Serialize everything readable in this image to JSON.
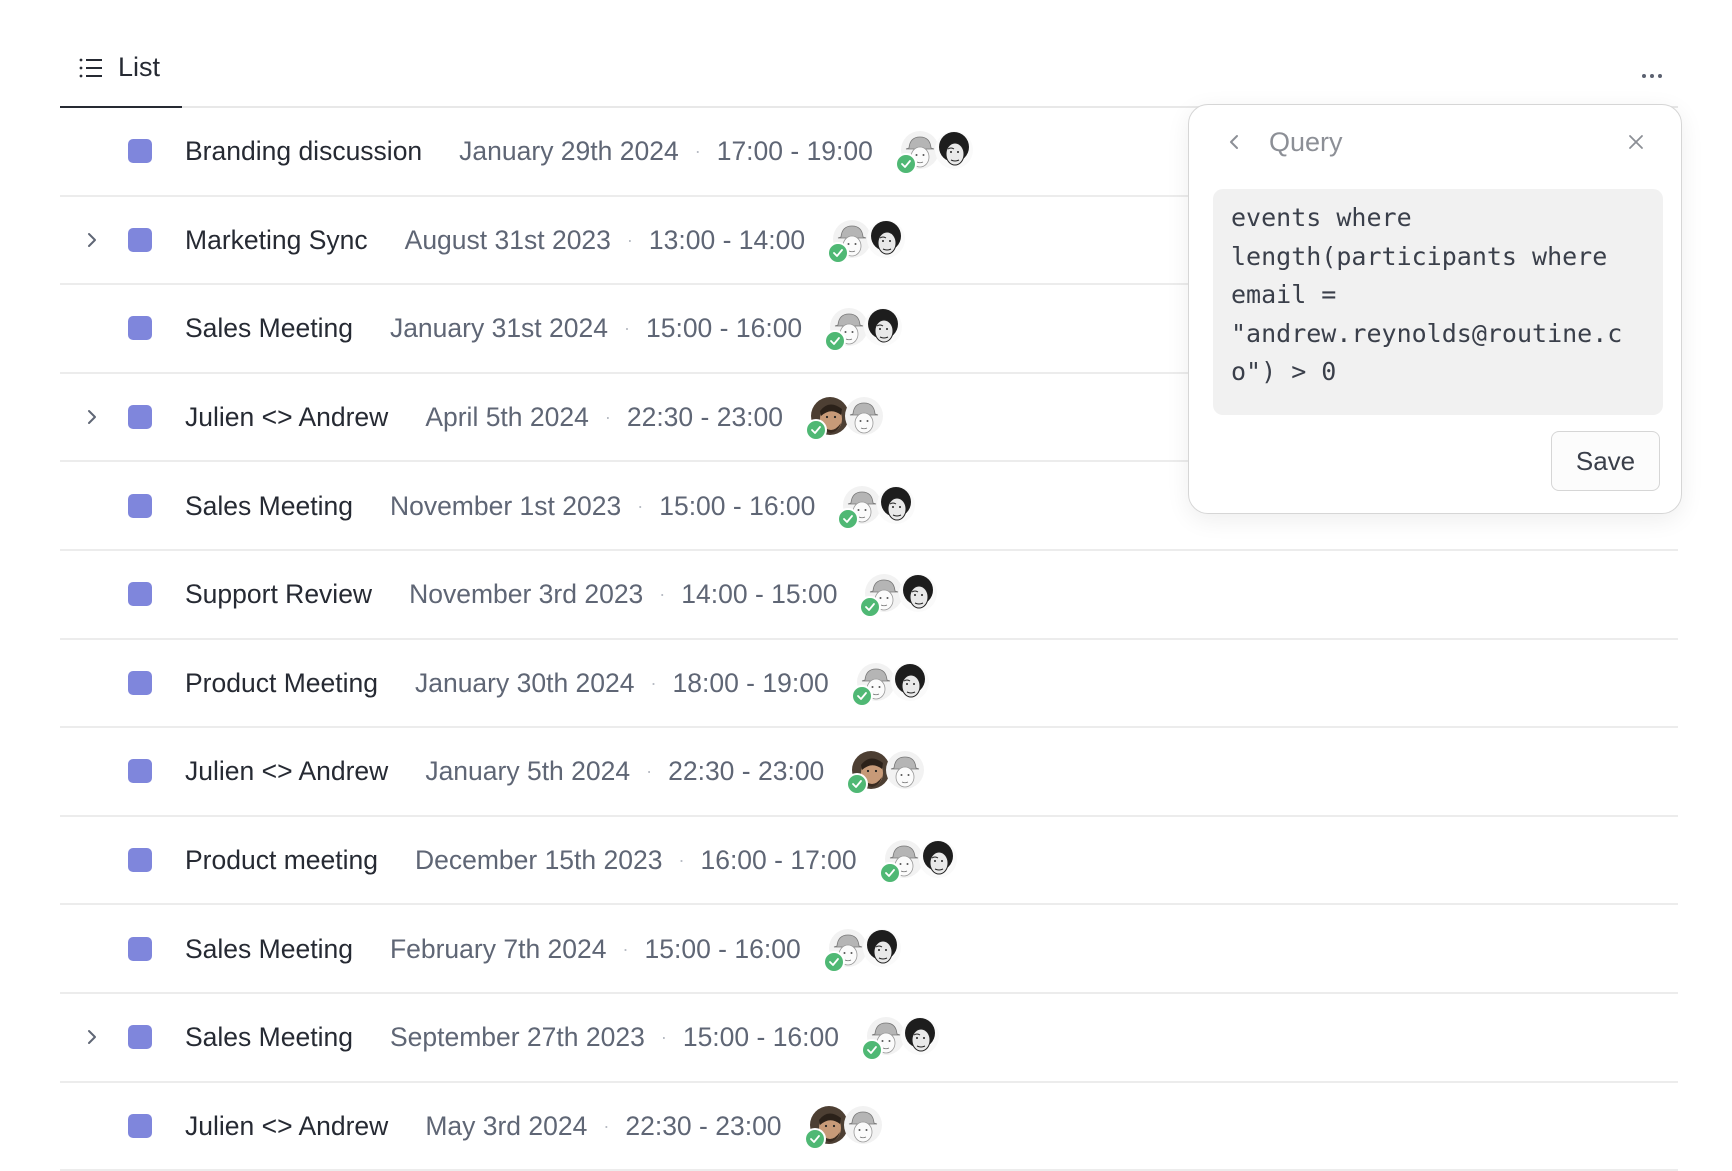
{
  "tabs": [
    {
      "label": "List",
      "icon": "list-icon",
      "active": true
    }
  ],
  "toolbar": {
    "more_icon": "ellipsis-icon"
  },
  "event_color": "#7f86dc",
  "rows": [
    {
      "title": "Branding discussion",
      "date": "January 29th 2024",
      "separator": "·",
      "time": "17:00 - 19:00",
      "expandable": false,
      "participants": [
        "cap",
        "curly"
      ]
    },
    {
      "title": "Marketing Sync",
      "date": "August 31st 2023",
      "separator": "·",
      "time": "13:00 - 14:00",
      "expandable": true,
      "participants": [
        "cap",
        "curly"
      ]
    },
    {
      "title": "Sales Meeting",
      "date": "January 31st 2024",
      "separator": "·",
      "time": "15:00 - 16:00",
      "expandable": false,
      "participants": [
        "cap",
        "curly"
      ]
    },
    {
      "title": "Julien <> Andrew",
      "date": "April 5th 2024",
      "separator": "·",
      "time": "22:30 - 23:00",
      "expandable": true,
      "participants": [
        "beard",
        "cap"
      ]
    },
    {
      "title": "Sales Meeting",
      "date": "November 1st 2023",
      "separator": "·",
      "time": "15:00 - 16:00",
      "expandable": false,
      "participants": [
        "cap",
        "curly"
      ]
    },
    {
      "title": "Support Review",
      "date": "November 3rd 2023",
      "separator": "·",
      "time": "14:00 - 15:00",
      "expandable": false,
      "participants": [
        "cap",
        "curly"
      ]
    },
    {
      "title": "Product Meeting",
      "date": "January 30th 2024",
      "separator": "·",
      "time": "18:00 - 19:00",
      "expandable": false,
      "participants": [
        "cap",
        "curly"
      ]
    },
    {
      "title": "Julien <> Andrew",
      "date": "January 5th 2024",
      "separator": "·",
      "time": "22:30 - 23:00",
      "expandable": false,
      "participants": [
        "beard",
        "cap"
      ]
    },
    {
      "title": "Product meeting",
      "date": "December 15th 2023",
      "separator": "·",
      "time": "16:00 - 17:00",
      "expandable": false,
      "participants": [
        "cap",
        "curly"
      ]
    },
    {
      "title": "Sales Meeting",
      "date": "February 7th 2024",
      "separator": "·",
      "time": "15:00 - 16:00",
      "expandable": false,
      "participants": [
        "cap",
        "curly"
      ]
    },
    {
      "title": "Sales Meeting",
      "date": "September 27th 2023",
      "separator": "·",
      "time": "15:00 - 16:00",
      "expandable": true,
      "participants": [
        "cap",
        "curly"
      ]
    },
    {
      "title": "Julien <> Andrew",
      "date": "May 3rd 2024",
      "separator": "·",
      "time": "22:30 - 23:00",
      "expandable": false,
      "participants": [
        "beard",
        "cap"
      ]
    }
  ],
  "query_panel": {
    "title": "Query",
    "query": "events where\nlength(participants where\nemail =\n\"andrew.reynolds@routine.c\no\") > 0",
    "save_label": "Save"
  }
}
